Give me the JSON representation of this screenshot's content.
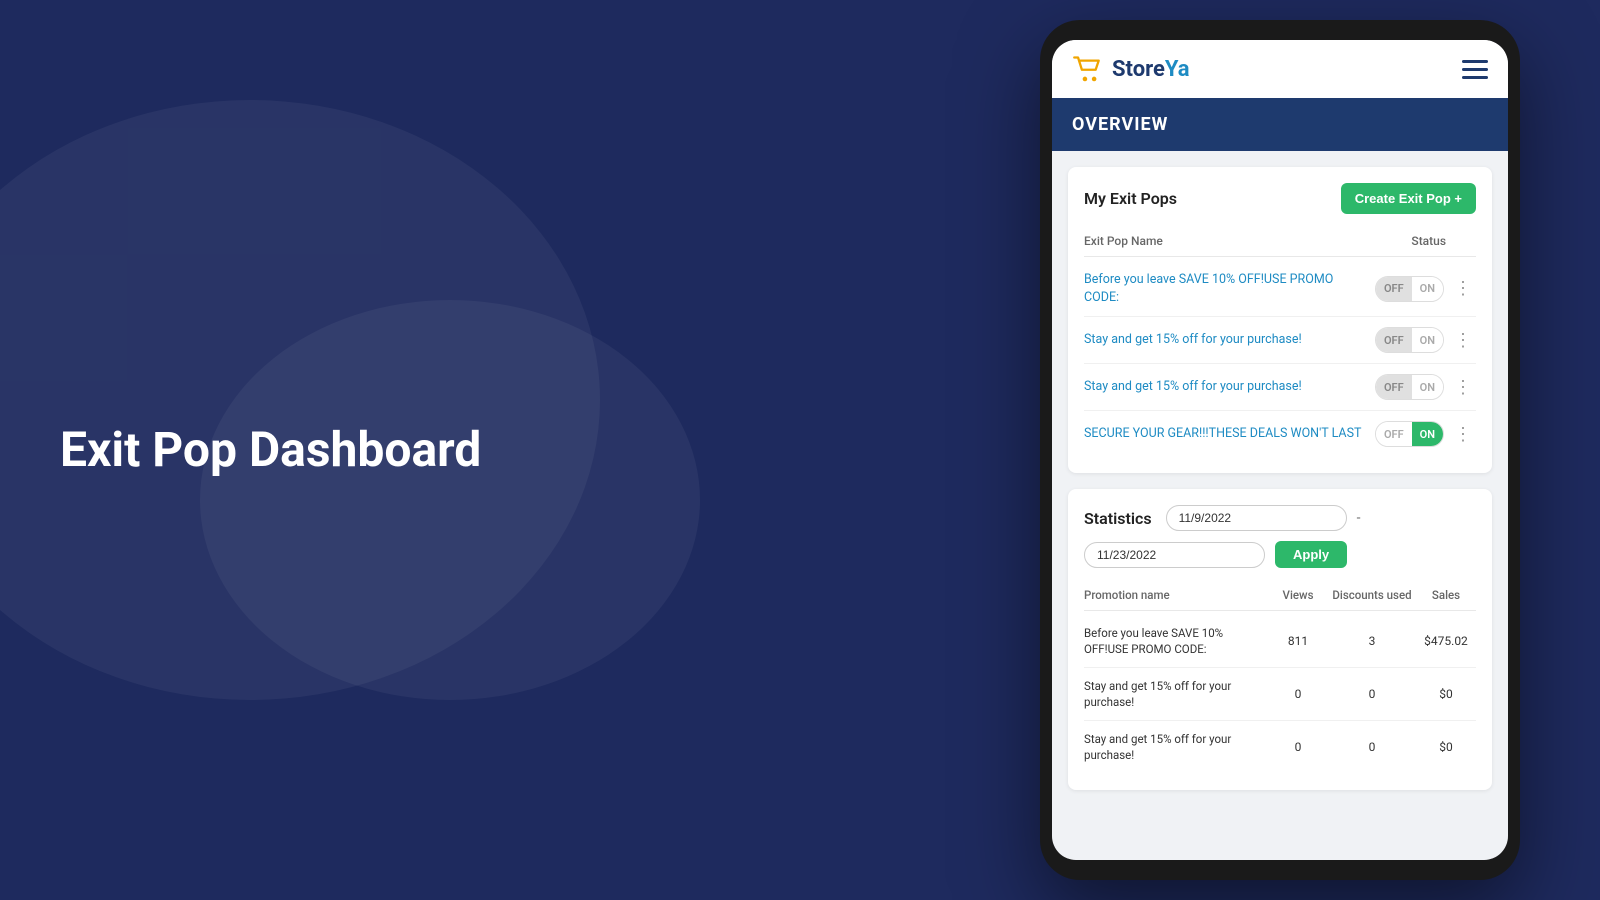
{
  "background": {
    "color": "#1e2a5e"
  },
  "left_section": {
    "title": "Exit Pop Dashboard"
  },
  "app": {
    "logo": {
      "store": "Store",
      "ya": "Ya",
      "full": "StoreYa"
    },
    "overview_label": "OVERVIEW",
    "exit_pops": {
      "section_title": "My Exit Pops",
      "create_button": "Create Exit Pop +",
      "col_name": "Exit Pop Name",
      "col_status": "Status",
      "items": [
        {
          "name": "Before you leave SAVE 10% OFF!USE PROMO CODE:",
          "status": "off"
        },
        {
          "name": "Stay and get 15% off for your purchase!",
          "status": "off"
        },
        {
          "name": "Stay and get 15% off for your purchase!",
          "status": "off"
        },
        {
          "name": "SECURE YOUR GEAR!!!THESE DEALS WON'T LAST",
          "status": "on"
        }
      ]
    },
    "statistics": {
      "section_title": "Statistics",
      "date_from": "11/9/2022",
      "date_to": "11/23/2022",
      "apply_button": "Apply",
      "separator": "-",
      "col_promotion": "Promotion name",
      "col_views": "Views",
      "col_discounts": "Discounts used",
      "col_sales": "Sales",
      "rows": [
        {
          "name": "Before you leave SAVE 10% OFF!USE PROMO CODE:",
          "views": "811",
          "discounts": "3",
          "sales": "$475.02"
        },
        {
          "name": "Stay and get 15% off for your purchase!",
          "views": "0",
          "discounts": "0",
          "sales": "$0"
        },
        {
          "name": "Stay and get 15% off for your purchase!",
          "views": "0",
          "discounts": "0",
          "sales": "$0"
        }
      ]
    }
  }
}
